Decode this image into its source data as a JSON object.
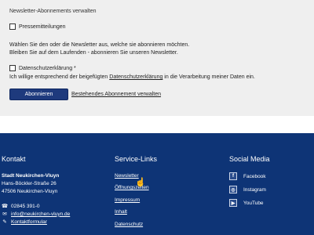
{
  "form": {
    "section_title": "Newsletter-Abonnements verwalten",
    "newsletter_option": "Pressemitteilungen",
    "info_line1": "Wählen Sie den oder die Newsletter aus, welche sie abonnieren möchten.",
    "info_line2": "Bleiben Sie auf dem Laufenden - abonnieren Sie unseren Newsletter.",
    "privacy_label": "Datenschutzerklärung *",
    "consent_before": "Ich willige entsprechend der beigefügten ",
    "consent_link": "Datenschutzerklärung",
    "consent_after": " in die Verarbeitung meiner Daten ein.",
    "subscribe_button": "Abonnieren",
    "manage_link": "Bestehendes Abonnement verwalten"
  },
  "footer": {
    "contact": {
      "heading": "Kontakt",
      "name": "Stadt Neukirchen-Vluyn",
      "street": "Hans-Böckler-Straße 26",
      "city": "47506 Neukirchen-Vluyn",
      "phone": "02845 391-0",
      "email": "info@neukirchen-vluyn.de",
      "form": "Kontaktformular"
    },
    "service": {
      "heading": "Service-Links",
      "links": [
        "Newsletter",
        "Öffnungszeiten",
        "Impressum",
        "Inhalt",
        "Datenschutz"
      ]
    },
    "social": {
      "heading": "Social Media",
      "items": [
        {
          "label": "Facebook",
          "icon": "facebook-icon"
        },
        {
          "label": "Instagram",
          "icon": "instagram-icon"
        },
        {
          "label": "YouTube",
          "icon": "youtube-icon"
        }
      ]
    }
  },
  "colors": {
    "footer_bg": "#0e3476",
    "button_bg": "#1e3a7d",
    "form_bg": "#efefef"
  }
}
